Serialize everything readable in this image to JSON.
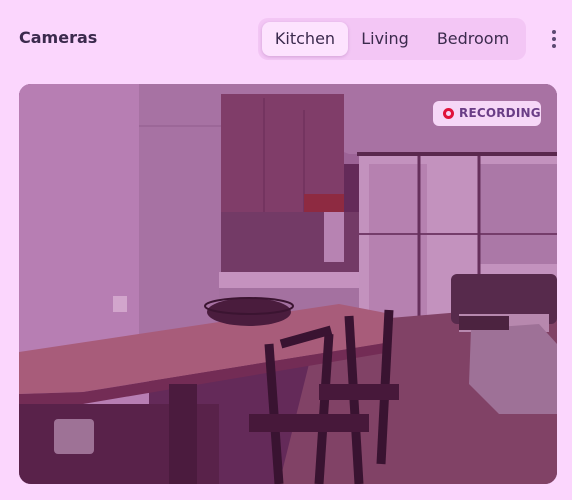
{
  "header": {
    "title": "Cameras"
  },
  "tabs": [
    {
      "label": "Kitchen",
      "active": true
    },
    {
      "label": "Living",
      "active": false
    },
    {
      "label": "Bedroom",
      "active": false
    }
  ],
  "menu": {
    "icon": "more-vertical-icon"
  },
  "feed": {
    "camera": "Kitchen",
    "status_label": "RECORDING",
    "status_icon": "record-icon",
    "status_color": "#e0123a"
  },
  "colors": {
    "background": "#fbd6fd",
    "tab_track": "#f3c6f5",
    "text": "#3b2a4d"
  }
}
